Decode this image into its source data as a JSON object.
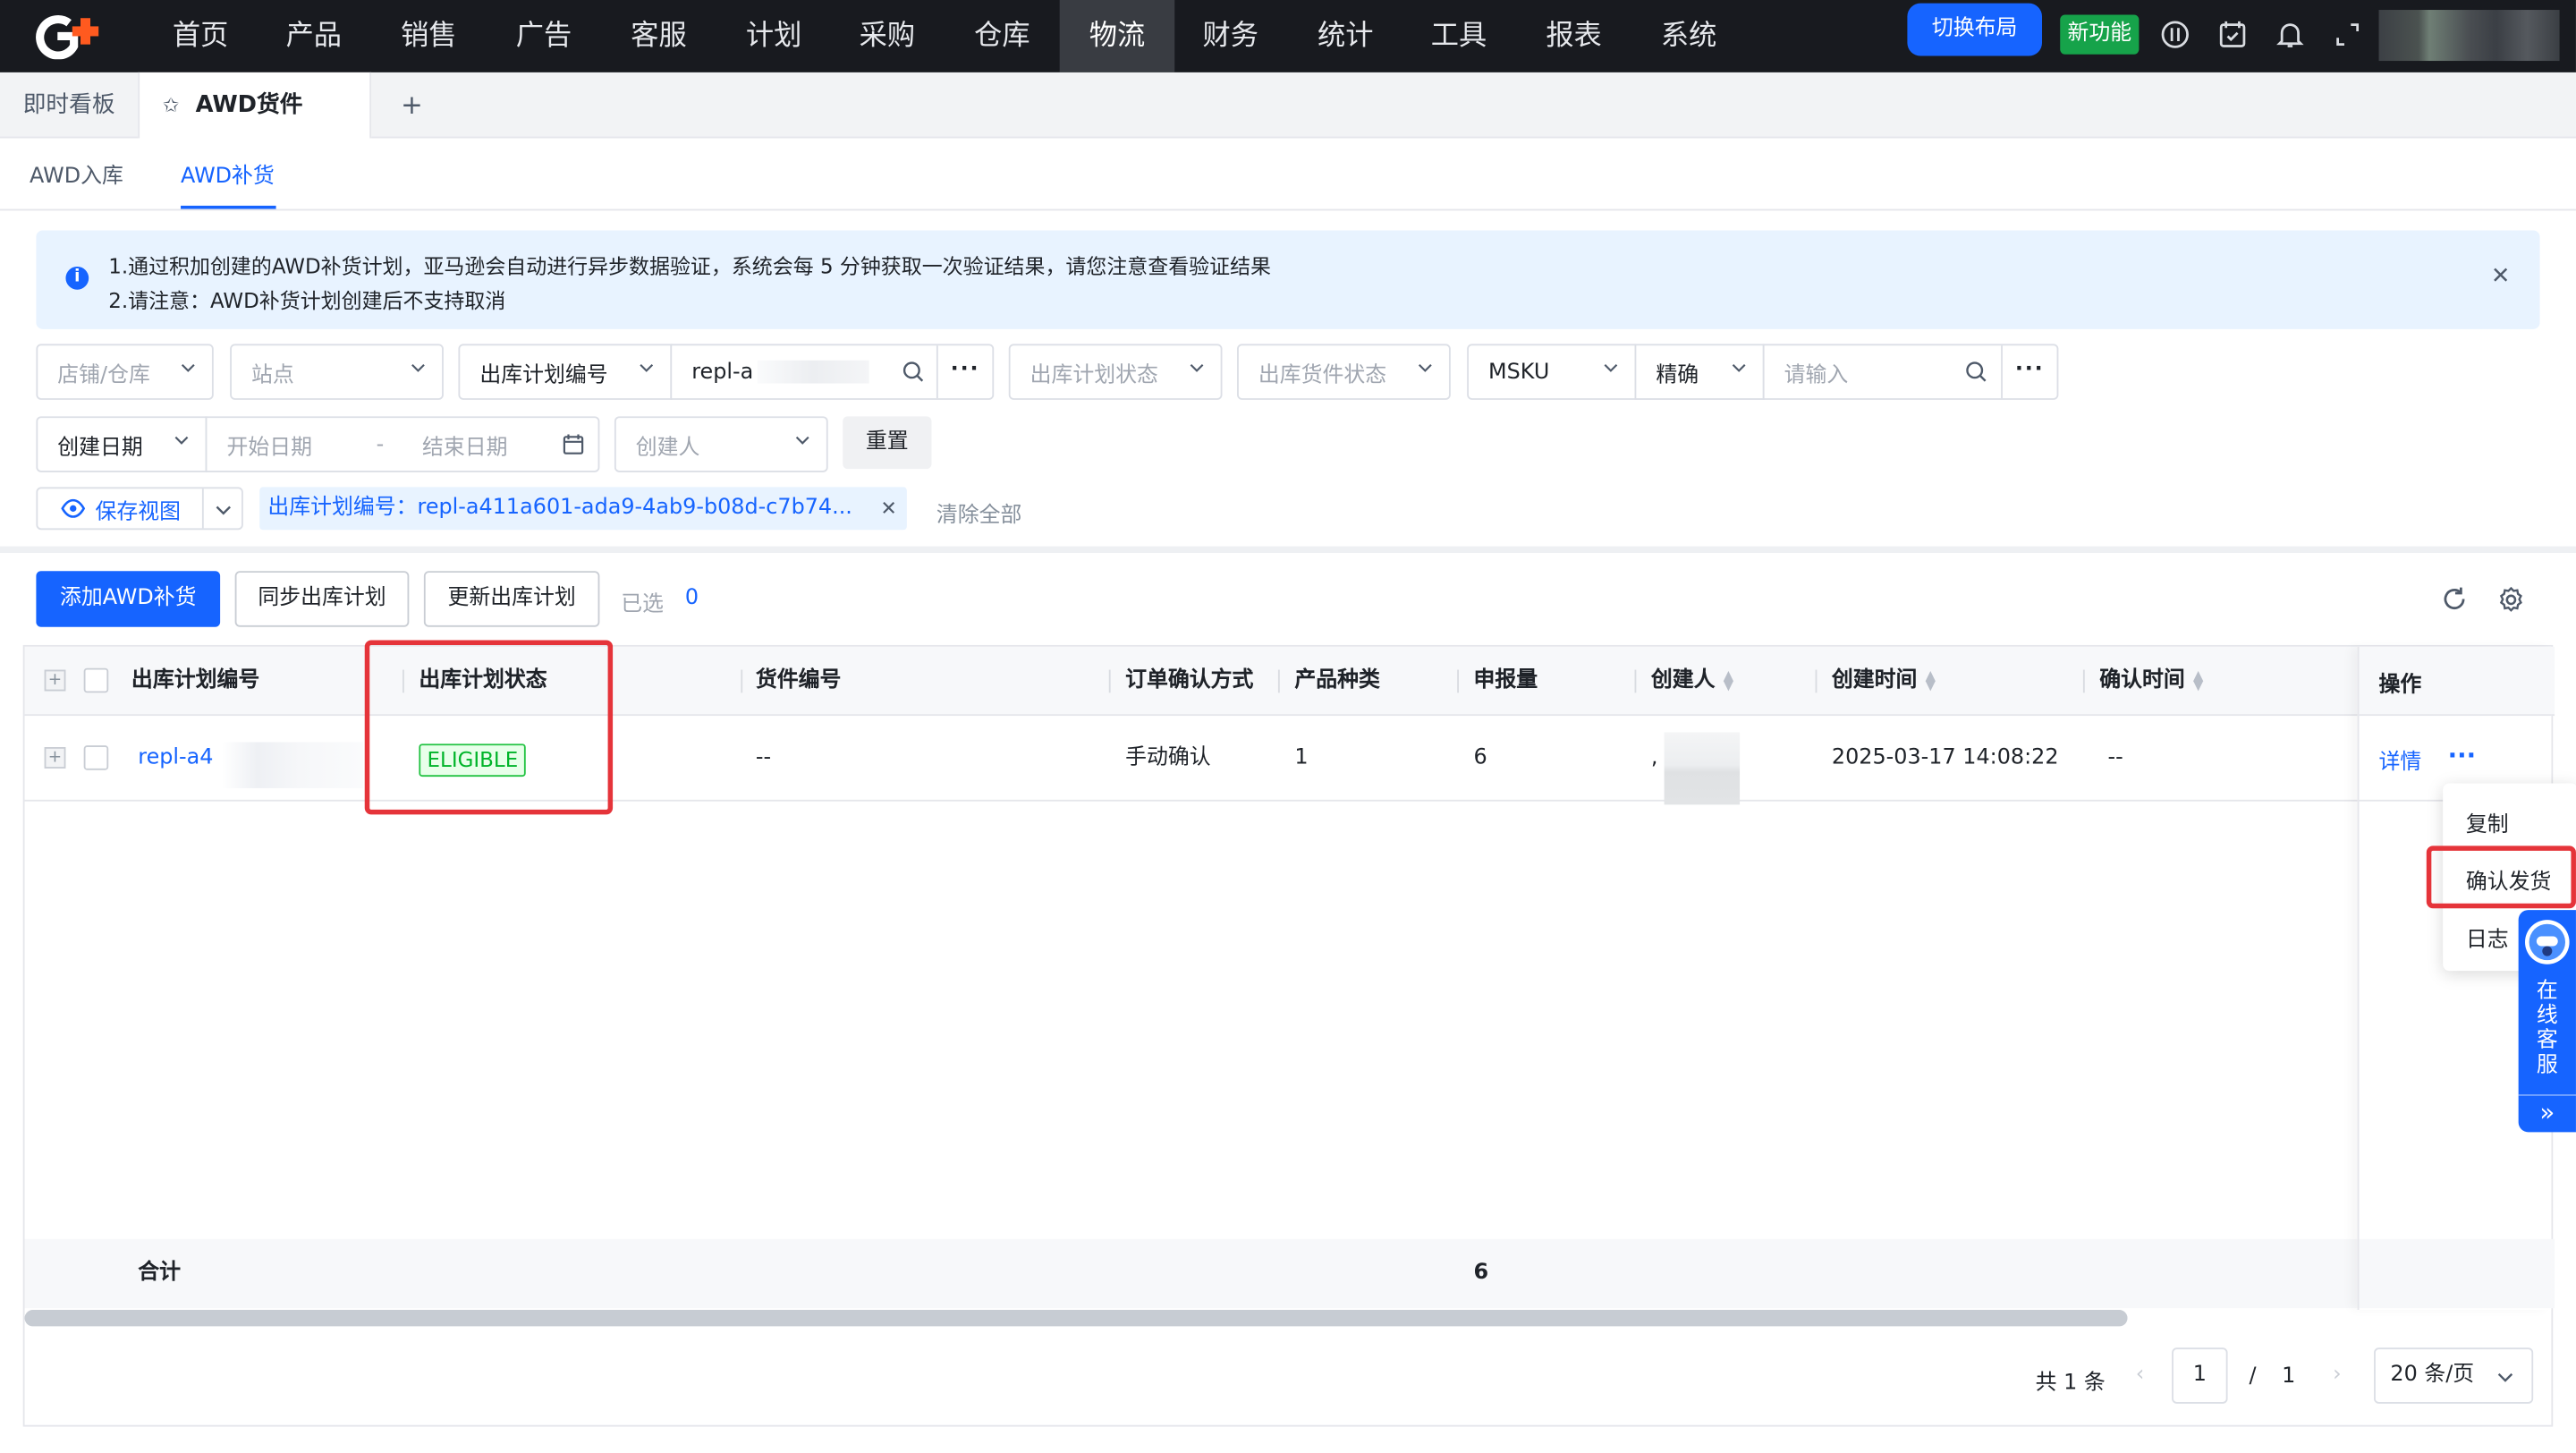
{
  "nav": {
    "items": [
      "首页",
      "产品",
      "销售",
      "广告",
      "客服",
      "计划",
      "采购",
      "仓库",
      "物流",
      "财务",
      "统计",
      "工具",
      "报表",
      "系统"
    ],
    "active": "物流",
    "switch_layout": "切换布局",
    "new_feature": "新功能"
  },
  "page_tabs": {
    "board": "即时看板",
    "active": "AWD货件",
    "add": "+"
  },
  "sub_tabs": {
    "inbound": "AWD入库",
    "replenish": "AWD补货"
  },
  "alert": {
    "line1": "1.通过积加创建的AWD补货计划，亚马逊会自动进行异步数据验证，系统会每 5 分钟获取一次验证结果，请您注意查看验证结果",
    "line2": "2.请注意：AWD补货计划创建后不支持取消"
  },
  "filters": {
    "store": "店铺/仓库",
    "site": "站点",
    "plan_no_select": "出库计划编号",
    "plan_no_value": "repl-a",
    "plan_status": "出库计划状态",
    "shipment_status": "出库货件状态",
    "msku": "MSKU",
    "exact": "精确",
    "input_placeholder": "请输入",
    "date_type": "创建日期",
    "start_date": "开始日期",
    "date_sep": "-",
    "end_date": "结束日期",
    "creator": "创建人",
    "reset": "重置",
    "save_view": "保存视图",
    "chip": "出库计划编号：repl-a411a601-ada9-4ab9-b08d-c7b74...",
    "clear_all": "清除全部"
  },
  "actions": {
    "add": "添加AWD补货",
    "sync": "同步出库计划",
    "update": "更新出库计划",
    "selected_label": "已选",
    "selected_count": "0"
  },
  "table": {
    "headers": {
      "plan_no": "出库计划编号",
      "plan_status": "出库计划状态",
      "shipment_no": "货件编号",
      "confirm_mode": "订单确认方式",
      "product_types": "产品种类",
      "declared_qty": "申报量",
      "creator": "创建人",
      "created_at": "创建时间",
      "confirmed_at": "确认时间",
      "ops": "操作"
    },
    "row": {
      "plan_no": "repl-a4",
      "plan_status": "ELIGIBLE",
      "shipment_no": "--",
      "confirm_mode": "手动确认",
      "product_types": "1",
      "declared_qty": "6",
      "creator": ",",
      "created_at": "2025-03-17 14:08:22",
      "confirmed_at": "--",
      "detail": "详情",
      "more": "···"
    },
    "total_label": "合计",
    "total_qty": "6"
  },
  "menu": {
    "copy": "复制",
    "confirm_ship": "确认发货",
    "log": "日志"
  },
  "pagination": {
    "total": "共 1 条",
    "current": "1",
    "sep": "/",
    "pages": "1",
    "page_size": "20 条/页"
  },
  "service": {
    "label": "在线客服",
    "expand": "»"
  },
  "colors": {
    "primary": "#1664ff",
    "nav_bg": "#181a1f",
    "success": "#00b42a",
    "highlight": "#e5343a"
  }
}
